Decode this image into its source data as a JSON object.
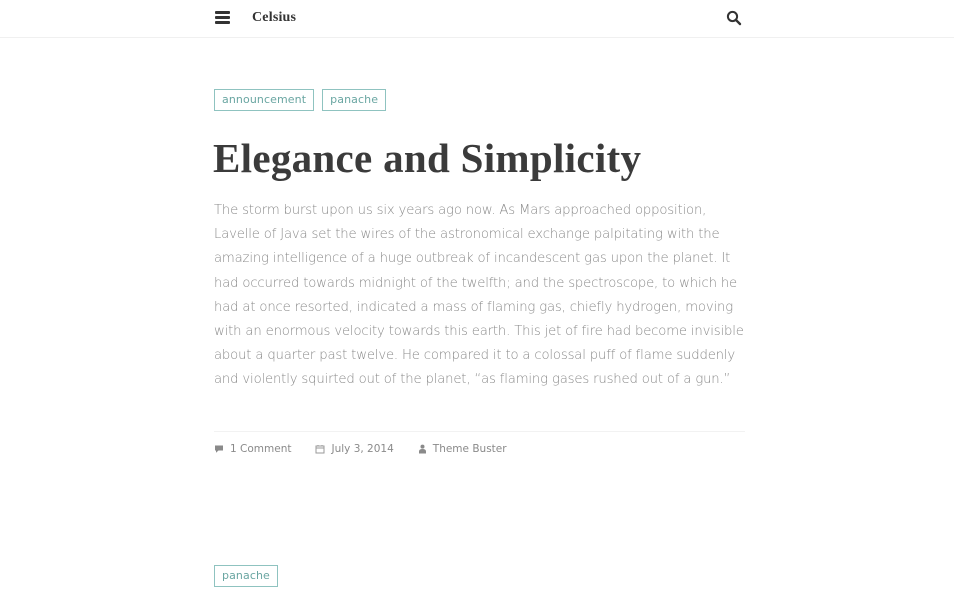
{
  "header": {
    "site_title": "Celsius",
    "menu_icon": "hamburger-menu-icon",
    "search_icon": "search-icon"
  },
  "posts": [
    {
      "tags": [
        "announcement",
        "panache"
      ],
      "title": "Elegance and Simplicity",
      "body": "The storm burst upon us six years ago now. As Mars approached opposition, Lavelle of Java set the wires of the astronomical exchange palpitating with the amazing intelligence of a huge outbreak of incandescent gas upon the planet. It had occurred towards midnight of the twelfth; and the spectroscope, to which he had at once resorted, indicated a mass of flaming gas, chiefly hydrogen, moving with an enormous velocity towards this earth. This jet of fire had become invisible about a quarter past twelve. He compared it to a colossal puff of flame suddenly and violently squirted out of the planet, “as flaming gases rushed out of a gun.”",
      "meta": {
        "comments": "1 Comment",
        "date": "July 3, 2014",
        "author": "Theme Buster",
        "comment_icon": "comment-icon",
        "date_icon": "calendar-icon",
        "author_icon": "user-icon"
      }
    },
    {
      "tags": [
        "panache"
      ]
    }
  ]
}
